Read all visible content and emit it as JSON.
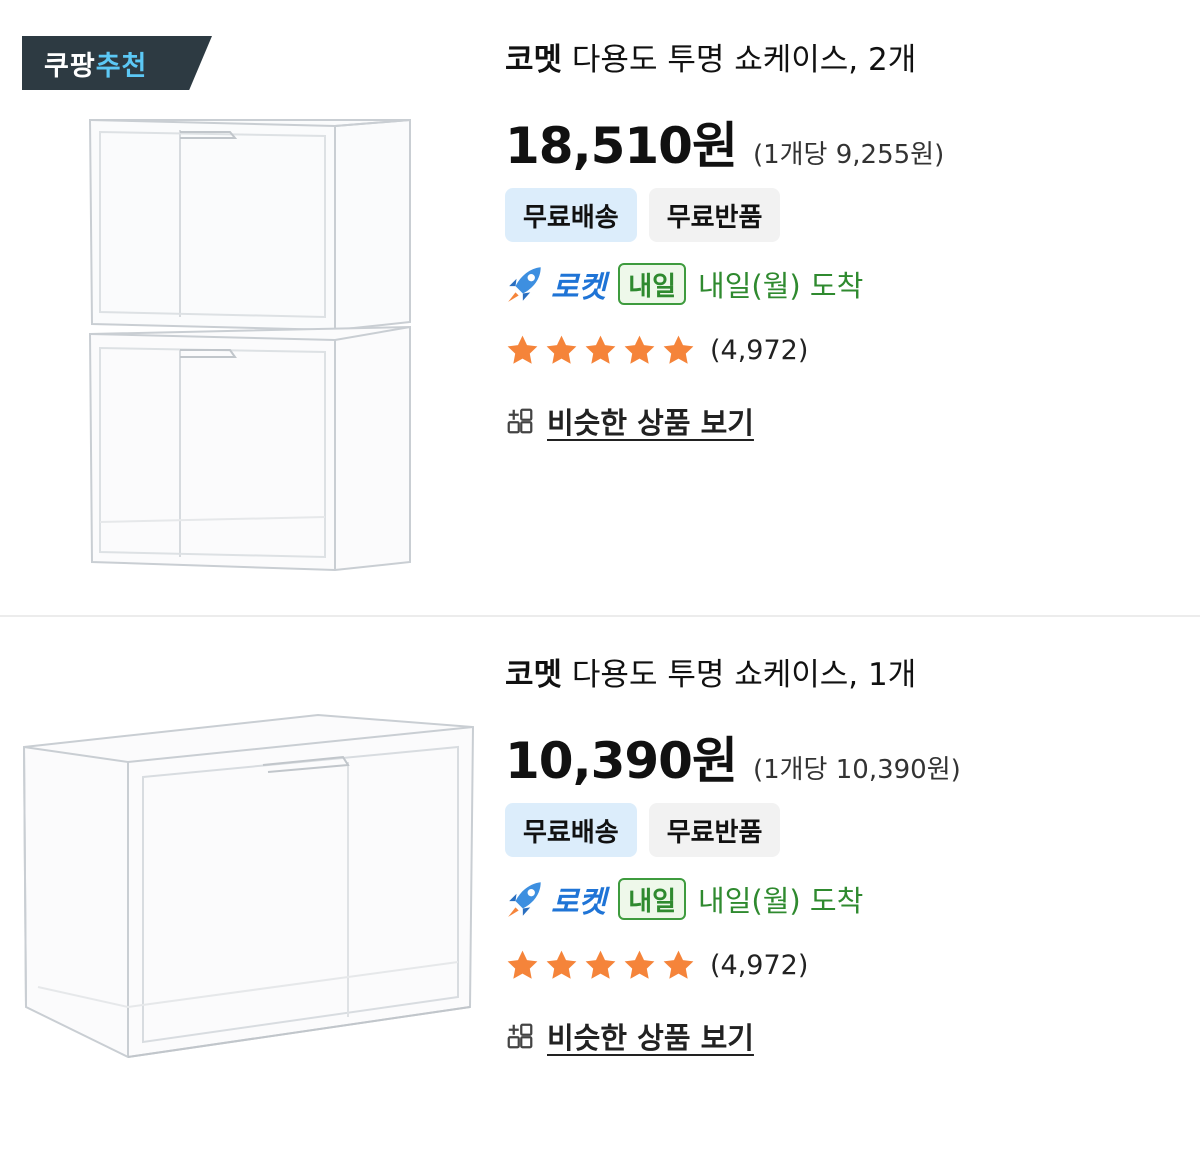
{
  "products": [
    {
      "recommend_badge": {
        "part1": "쿠팡",
        "part2": "추천"
      },
      "brand": "코멧",
      "name": "다용도 투명 쇼케이스, 2개",
      "price": "18,510원",
      "unit_price": "(1개당 9,255원)",
      "tags": {
        "shipping": "무료배송",
        "returns": "무료반품"
      },
      "delivery": {
        "rocket": "로켓",
        "badge": "내일",
        "arrival": "내일(월) 도착"
      },
      "rating": {
        "stars": 5,
        "max": 5,
        "count": "(4,972)"
      },
      "similar_link": "비슷한 상품 보기",
      "image_icon": "stacked-clear-showcase-image"
    },
    {
      "brand": "코멧",
      "name": "다용도 투명 쇼케이스, 1개",
      "price": "10,390원",
      "unit_price": "(1개당 10,390원)",
      "tags": {
        "shipping": "무료배송",
        "returns": "무료반품"
      },
      "delivery": {
        "rocket": "로켓",
        "badge": "내일",
        "arrival": "내일(월) 도착"
      },
      "rating": {
        "stars": 5,
        "max": 5,
        "count": "(4,972)"
      },
      "similar_link": "비슷한 상품 보기",
      "image_icon": "single-clear-showcase-image"
    }
  ],
  "colors": {
    "star": "#f5843a",
    "rocket_blue": "#1f74d6",
    "tomorrow_green": "#2f8a2f",
    "badge_dark": "#2d3a42",
    "badge_blue": "#5cc8f5",
    "shipping_tag_bg": "#dcedfb"
  }
}
